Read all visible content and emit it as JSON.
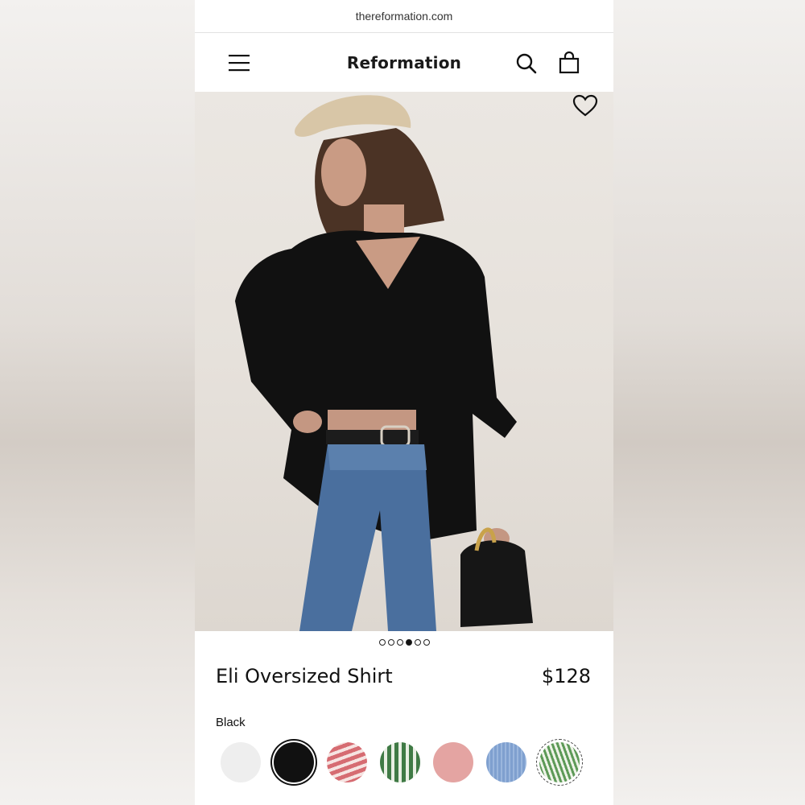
{
  "browser": {
    "url": "thereformation.com"
  },
  "header": {
    "brand": "Reformation",
    "menu_icon": "hamburger-menu-icon",
    "search_icon": "search-icon",
    "bag_icon": "shopping-bag-icon"
  },
  "gallery": {
    "wishlist_icon": "heart-icon",
    "slide_count": 6,
    "active_slide": 4
  },
  "product": {
    "name": "Eli Oversized Shirt",
    "price": "$128",
    "selected_color": "Black"
  },
  "swatches": [
    {
      "name": "white",
      "color": "#eeeeee",
      "pattern": "solid"
    },
    {
      "name": "black",
      "color": "#111111",
      "pattern": "solid",
      "selected": true
    },
    {
      "name": "red-stripe",
      "color": "#d66c72",
      "pattern": "stripe-diagonal"
    },
    {
      "name": "green-stripe",
      "color": "#3f7a45",
      "pattern": "stripe-vertical"
    },
    {
      "name": "pink",
      "color": "#e4a4a2",
      "pattern": "solid"
    },
    {
      "name": "blue",
      "color": "#7fa0cf",
      "pattern": "pinstripe"
    },
    {
      "name": "green-pinstripe",
      "color": "#5e9a58",
      "pattern": "stripe-diagonal-fine"
    }
  ],
  "colors": {
    "accent": "#111111",
    "background": "#ffffff"
  }
}
